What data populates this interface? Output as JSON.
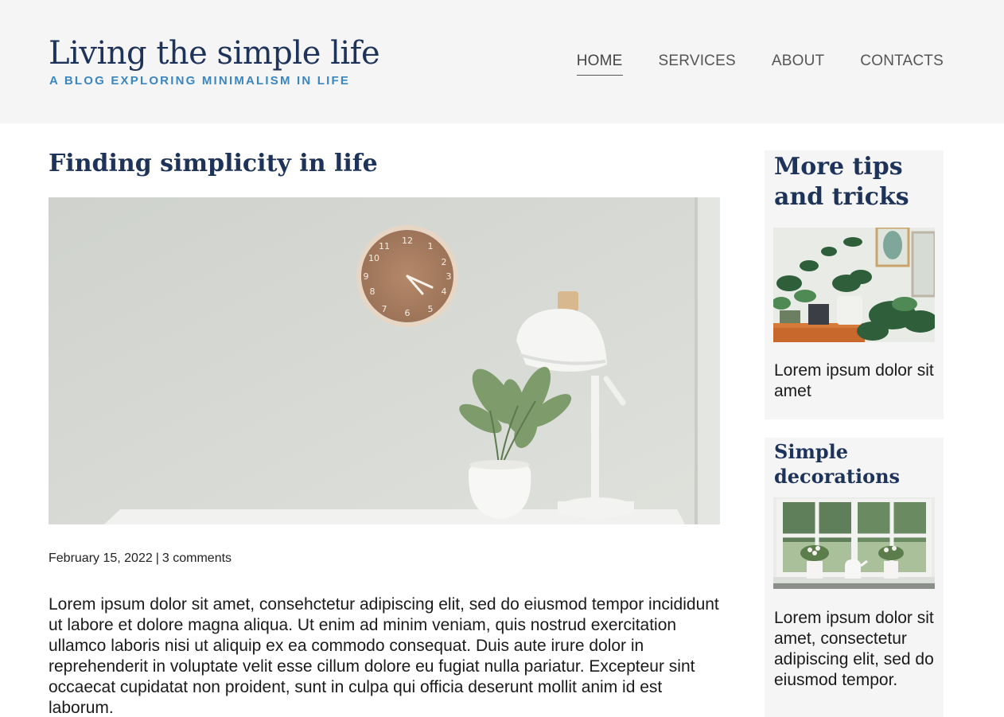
{
  "header": {
    "title": "Living the simple life",
    "tagline": "A BLOG EXPLORING MINIMALISM IN LIFE",
    "nav": [
      {
        "label": "HOME",
        "active": true
      },
      {
        "label": "SERVICES",
        "active": false
      },
      {
        "label": "ABOUT",
        "active": false
      },
      {
        "label": "CONTACTS",
        "active": false
      }
    ]
  },
  "article": {
    "title": "Finding simplicity in life",
    "image_alt": "Wall clock, white desk lamp and potted plant on white table",
    "date": "February 15, 2022",
    "separator": "|",
    "comments": "3 comments",
    "body": "Lorem ipsum dolor sit amet, consehctetur adipiscing elit, sed do eiusmod tempor incididunt ut labore et dolore magna aliqua. Ut enim ad minim veniam, quis nostrud exercitation ullamco laboris nisi ut aliquip ex ea commodo consequat. Duis aute irure dolor in reprehenderit in voluptate velit esse cillum dolore eu fugiat nulla pariatur. Excepteur sint occaecat cupidatat non proident, sunt in culpa qui officia deserunt mollit anim id est laborum."
  },
  "sidebar": {
    "cards": [
      {
        "title": "More tips and tricks",
        "image": "plants-shelf-photo",
        "text": "Lorem ipsum dolor sit amet"
      },
      {
        "title": "Simple decorations",
        "image": "window-plants-photo",
        "text": "Lorem ipsum dolor sit amet, consectetur adipiscing elit, sed do eiusmod tempor."
      }
    ]
  },
  "colors": {
    "header_bg": "#f5f5f5",
    "title": "#1e3359",
    "tagline": "#3a86bf",
    "nav": "#555555",
    "card_bg": "#f5f5f5"
  }
}
